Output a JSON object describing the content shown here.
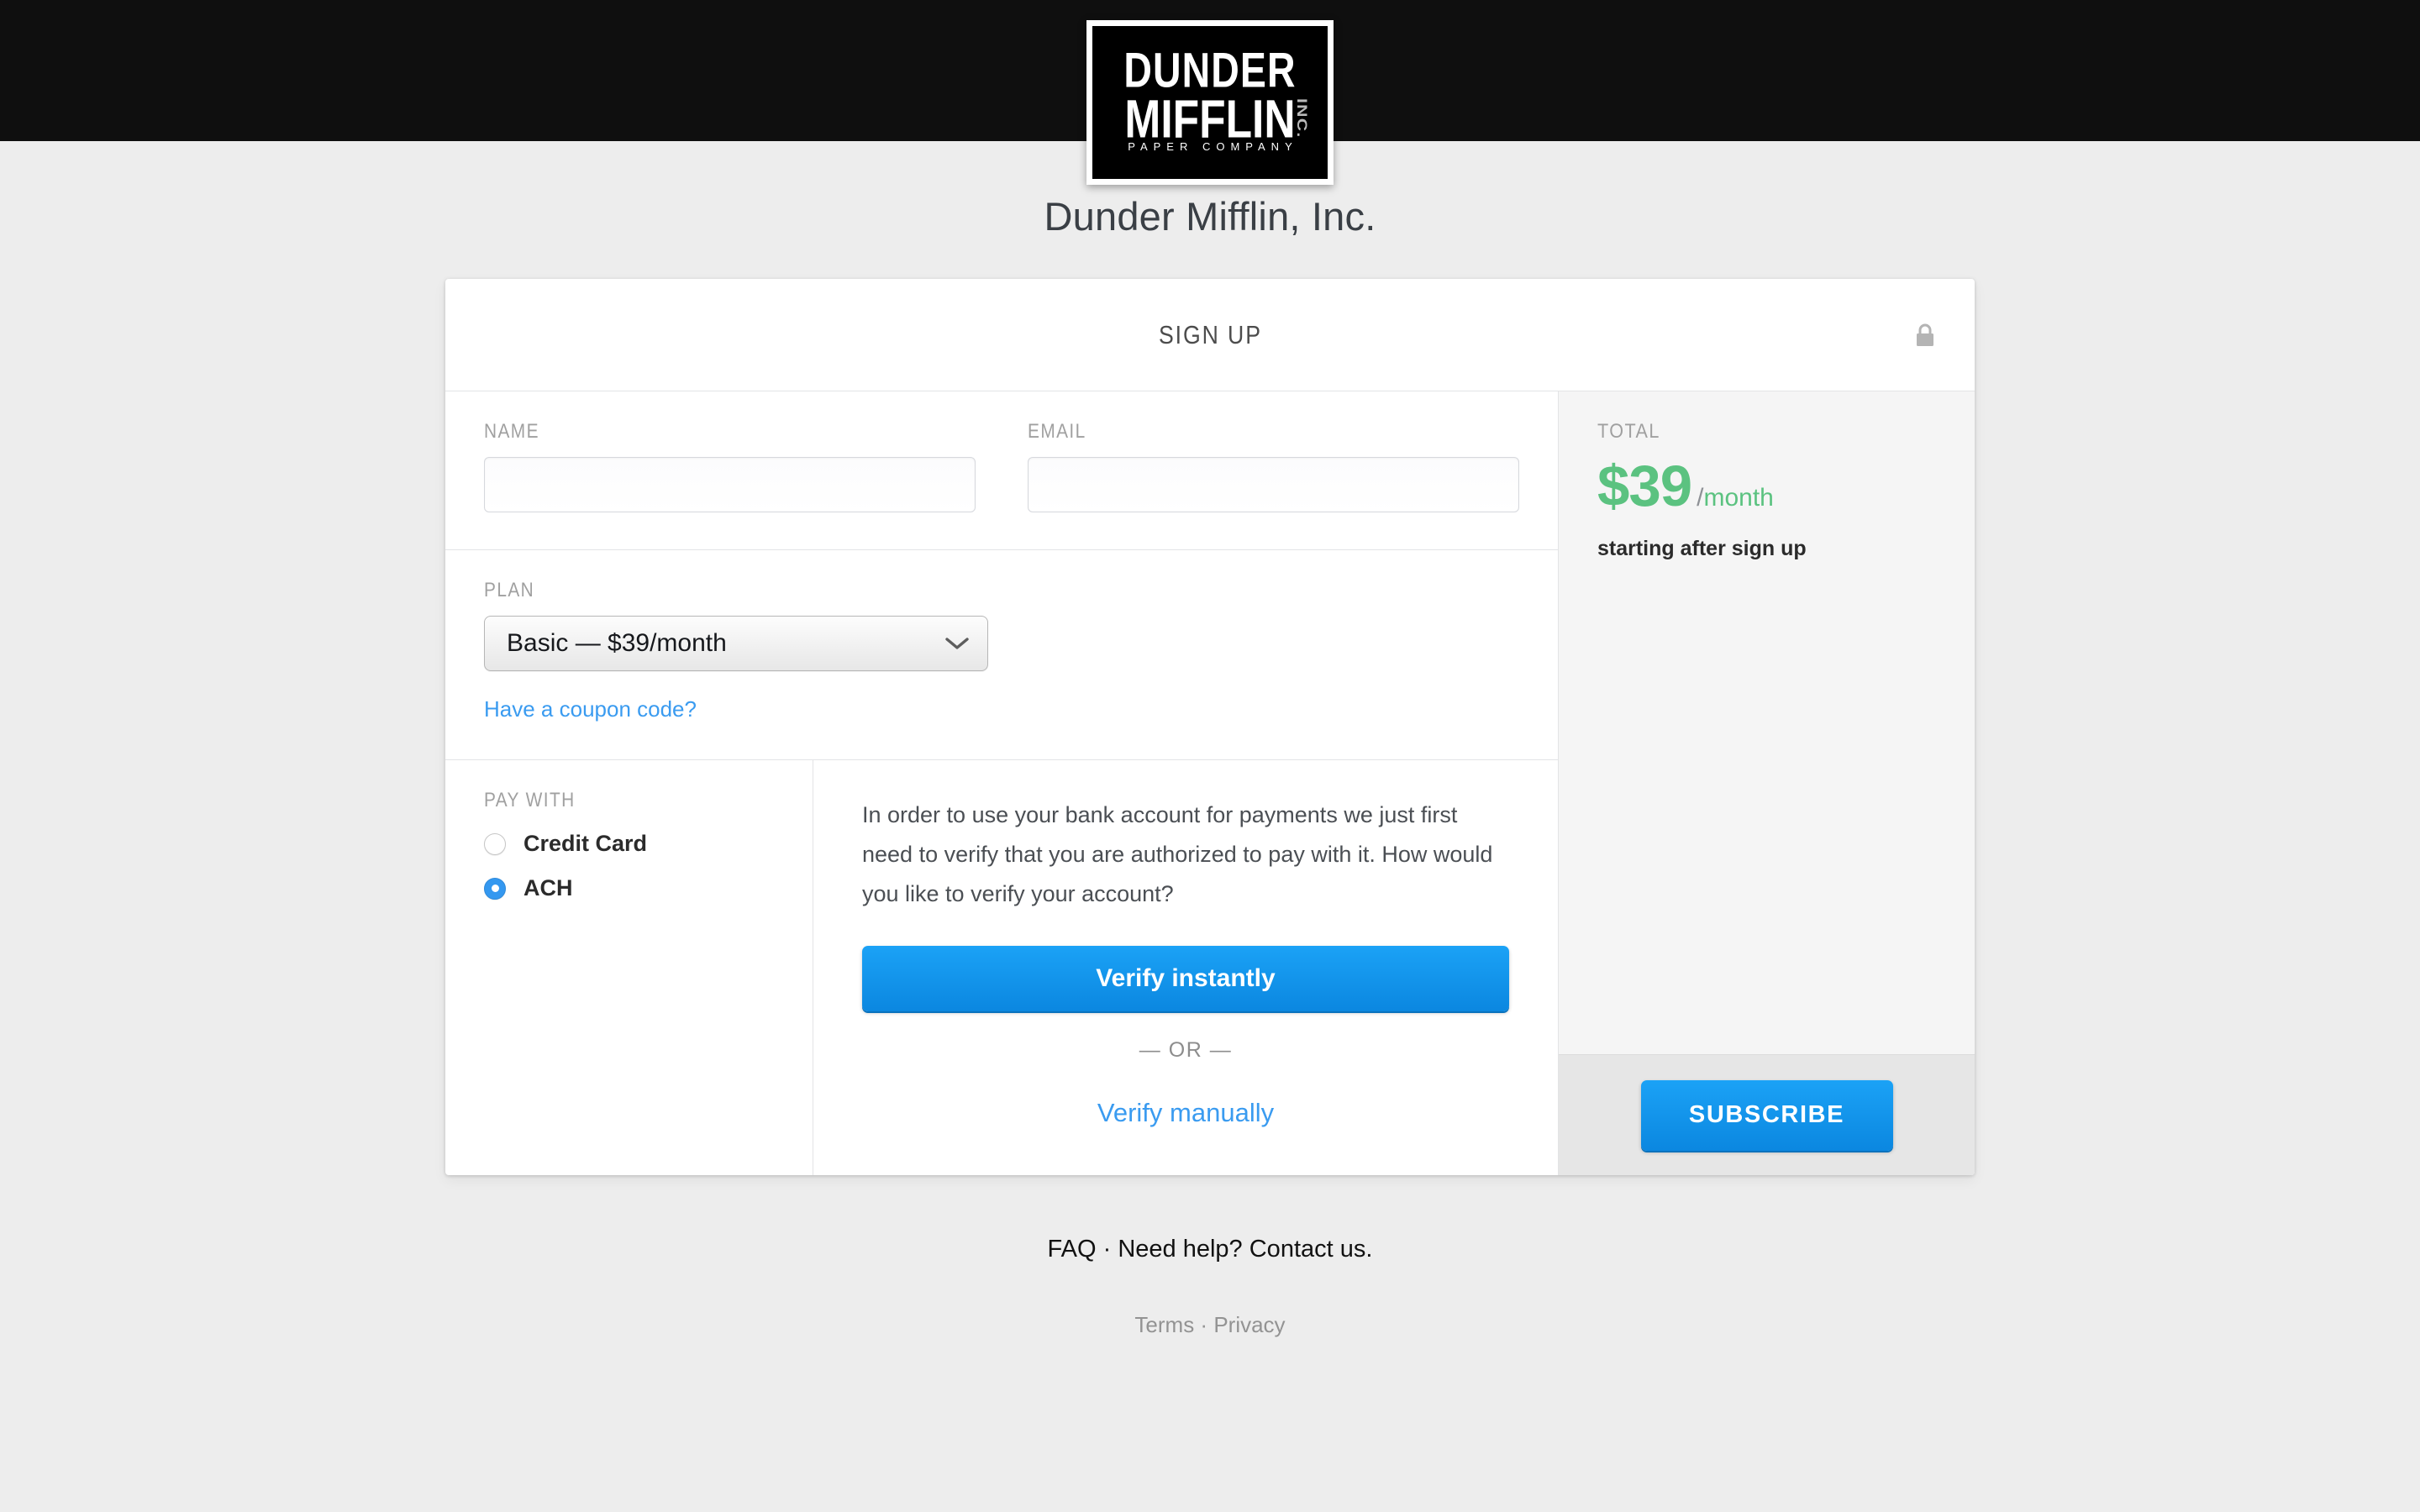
{
  "logo": {
    "line1": "DUNDER",
    "line2": "MIFFLIN",
    "inc": "INC.",
    "line3": "PAPER COMPANY",
    "alt": "dunder-mifflin-logo"
  },
  "page": {
    "title": "Dunder Mifflin, Inc.",
    "background_color": "#ededed",
    "topbar_color": "#0f0f0f"
  },
  "card": {
    "header": {
      "title": "SIGN UP",
      "lock_icon": "lock-icon"
    },
    "fields": {
      "name_label": "NAME",
      "name_value": "",
      "name_placeholder": "",
      "email_label": "EMAIL",
      "email_value": "",
      "email_placeholder": ""
    },
    "plan": {
      "label": "PLAN",
      "selected": "Basic — $39/month",
      "options": [
        "Basic — $39/month"
      ],
      "chevron_icon": "chevron-down-icon",
      "coupon_link": "Have a coupon code?"
    },
    "pay_with": {
      "label": "PAY WITH",
      "options": [
        {
          "label": "Credit Card",
          "selected": false
        },
        {
          "label": "ACH",
          "selected": true
        }
      ]
    },
    "verify": {
      "description": "In order to use your bank account for payments we just first need to verify that you are authorized to pay with it. How would you like to verify your account?",
      "instant_button": "Verify instantly",
      "or_separator": "— OR —",
      "manual_link": "Verify manually"
    },
    "total": {
      "label": "TOTAL",
      "amount": "$39",
      "slash": "/",
      "period": "month",
      "note": "starting after sign up",
      "accent_color": "#5bc280"
    },
    "subscribe": {
      "label": "SUBSCRIBE",
      "accent_color": "#0b87e0"
    }
  },
  "footer": {
    "faq": "FAQ",
    "sep1": " · ",
    "help": "Need help? Contact us.",
    "terms": "Terms",
    "sep2": " · ",
    "privacy": "Privacy"
  }
}
